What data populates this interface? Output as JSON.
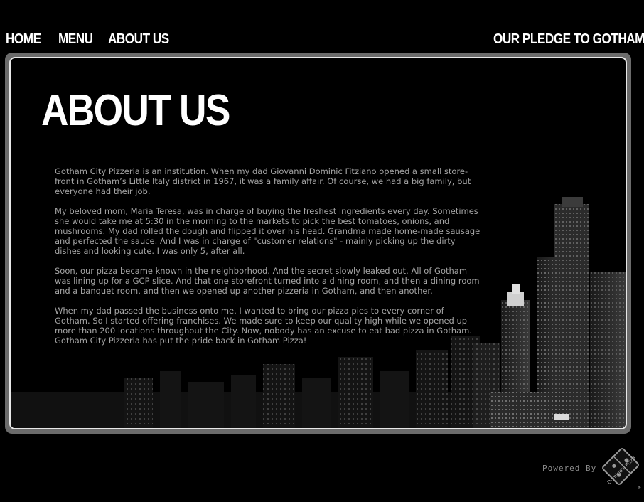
{
  "nav": {
    "home": "HOME",
    "menu": "MENU",
    "about": "ABOUT US",
    "pledge": "OUR PLEDGE TO GOTHAM"
  },
  "page": {
    "title": "ABOUT US",
    "paragraphs": [
      "Gotham City Pizzeria is an institution. When my dad Giovanni Dominic Fitziano opened a small store-front in Gotham’s Little Italy district in 1967, it was a family affair. Of course, we had a big family, but everyone had their job.",
      "My beloved mom, Maria Teresa, was in charge of buying the freshest ingredients every day. Sometimes she would take me at 5:30 in the morning to the markets to pick the best tomatoes, onions, and mushrooms. My dad rolled the dough and flipped it over his head. Grandma made home-made sausage and perfected the sauce. And I was in charge of \"customer relations\" - mainly picking up the dirty dishes and looking cute. I was only 5, after all.",
      "Soon, our pizza became known in the neighborhood. And the secret slowly leaked out. All of Gotham was lining up for a GCP slice. And that one storefront turned into a dining room, and then a dining room and a banquet room, and then we opened up another pizzeria in Gotham, and then another.",
      "When my dad passed the business onto me, I wanted to bring our pizza pies to every corner of Gotham. So I started offering franchises. We made sure to keep our quality high while we opened up more than 200 locations throughout the City. Now, nobody has an excuse to eat bad pizza in Gotham. Gotham City Pizzeria has put the pride back in Gotham Pizza!"
    ]
  },
  "footer": {
    "powered_by": "Powered By",
    "logo_text": "Domino's Pizza",
    "logo_mark": "®"
  },
  "colors": {
    "background": "#000000",
    "frame": "#6b6b6b",
    "panel_border": "#e8e8e8",
    "nav_text": "#ffffff",
    "body_text": "#a4a4a4"
  },
  "icons": {
    "logo": "dominos-logo-icon",
    "skyline": "city-skyline-illustration"
  }
}
